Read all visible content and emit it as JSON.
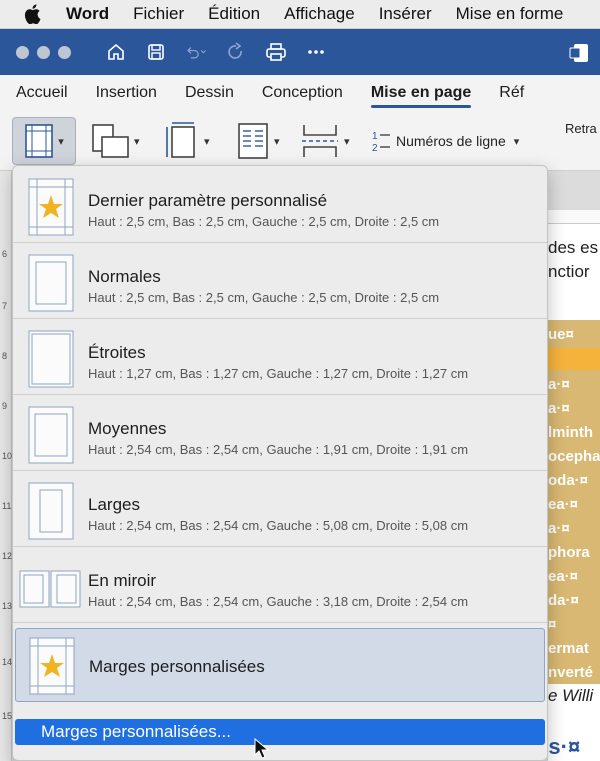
{
  "menubar": {
    "apple": "",
    "items": [
      "Word",
      "Fichier",
      "Édition",
      "Affichage",
      "Insérer",
      "Mise en forme"
    ]
  },
  "ribbon_tabs": [
    "Accueil",
    "Insertion",
    "Dessin",
    "Conception",
    "Mise en page",
    "Réf"
  ],
  "active_tab": "Mise en page",
  "toolbar": {
    "line_numbers_label": "Numéros de ligne",
    "retrait_label": "Retra"
  },
  "menu": {
    "items": [
      {
        "name": "Dernier paramètre personnalisé",
        "desc": "Haut : 2,5 cm, Bas : 2,5 cm, Gauche : 2,5 cm, Droite : 2,5 cm",
        "icon": "star-page-icon"
      },
      {
        "name": "Normales",
        "desc": "Haut : 2,5 cm, Bas : 2,5 cm, Gauche : 2,5 cm, Droite : 2,5 cm",
        "icon": "page-normal-icon"
      },
      {
        "name": "Étroites",
        "desc": "Haut : 1,27 cm, Bas : 1,27 cm, Gauche : 1,27 cm, Droite : 1,27 cm",
        "icon": "page-narrow-icon"
      },
      {
        "name": "Moyennes",
        "desc": "Haut : 2,54 cm, Bas : 2,54 cm, Gauche : 1,91 cm, Droite : 1,91 cm",
        "icon": "page-moderate-icon"
      },
      {
        "name": "Larges",
        "desc": "Haut : 2,54 cm, Bas : 2,54 cm, Gauche : 5,08 cm, Droite : 5,08 cm",
        "icon": "page-wide-icon"
      },
      {
        "name": "En miroir",
        "desc": "Haut : 2,54 cm, Bas : 2,54 cm, Gauche : 3,18 cm, Droite : 2,54 cm",
        "icon": "page-mirror-icon"
      }
    ],
    "selected": {
      "name": "Marges personnalisées"
    },
    "bottom": "Marges personnalisées..."
  },
  "document": {
    "line1": "des es",
    "line2": "nctior",
    "cells": [
      "ue¤",
      "a·¤",
      "a·¤",
      "lminth",
      "ocepha",
      "oda·¤",
      "ea·¤",
      "a·¤",
      "phora",
      "ea·¤",
      "da·¤",
      "¤",
      "ermat",
      "nverté"
    ],
    "line3": "e Willi",
    "heading": "Invertébrés·¤"
  },
  "ruler_numbers": [
    "6",
    "7",
    "8",
    "9",
    "10",
    "11",
    "12",
    "13",
    "14",
    "15"
  ],
  "colors": {
    "word_blue": "#2b579a",
    "highlight": "#1f6fe0",
    "selected_bg": "#d1dae6",
    "gold_star": "#f0b323"
  }
}
